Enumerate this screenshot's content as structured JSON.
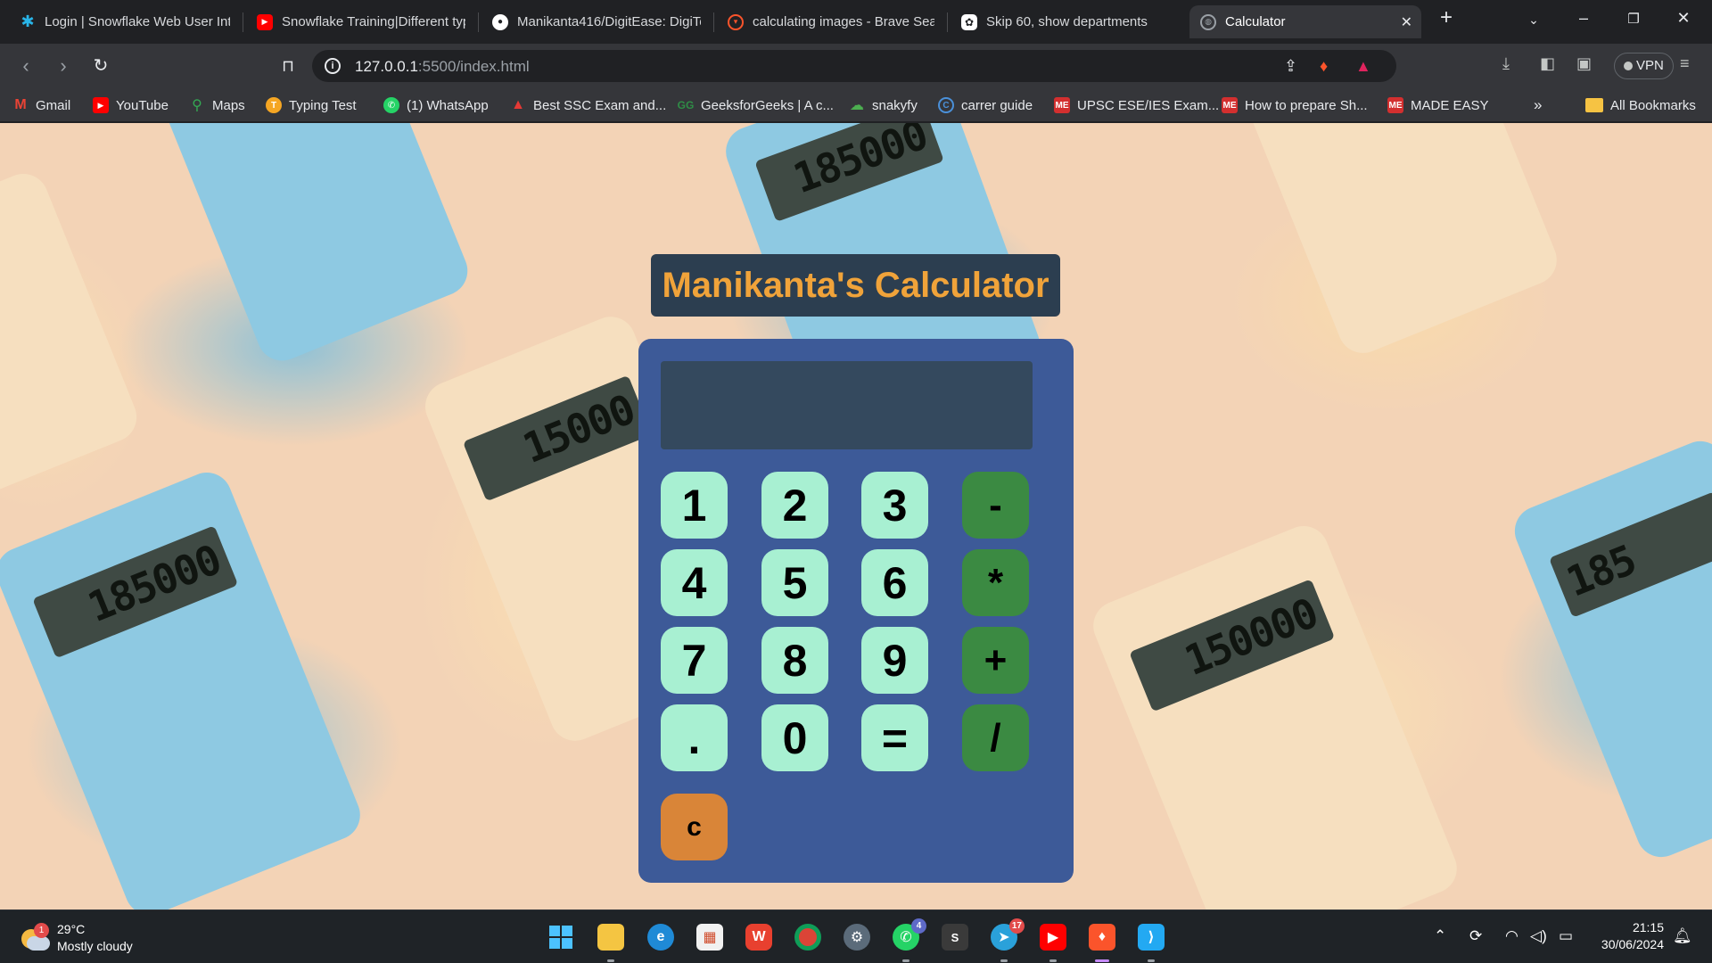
{
  "browser": {
    "tabs": [
      {
        "label": "Login | Snowflake Web User Int",
        "icon": "snowflake-icon",
        "color": "#29b5e8"
      },
      {
        "label": "Snowflake Training|Different typ",
        "icon": "youtube-icon",
        "color": "#ff0000"
      },
      {
        "label": "Manikanta416/DigitEase: DigiTe",
        "icon": "github-icon",
        "color": "#ffffff"
      },
      {
        "label": "calculating images - Brave Searc",
        "icon": "brave-search-icon",
        "color": "#fb542b"
      },
      {
        "label": "Skip 60, show departments",
        "icon": "chatgpt-icon",
        "color": "#ffffff"
      },
      {
        "label": "Calculator",
        "icon": "globe-icon",
        "color": "#9aa0a6",
        "active": true
      }
    ],
    "address": {
      "host": "127.0.0.1",
      "rest": ":5500/index.html"
    },
    "vpn_label": "VPN",
    "bookmarks": [
      {
        "label": "Gmail",
        "icon": "gmail-icon",
        "color": "#ea4335"
      },
      {
        "label": "YouTube",
        "icon": "youtube-icon",
        "color": "#ff0000"
      },
      {
        "label": "Maps",
        "icon": "maps-icon",
        "color": "#34a853"
      },
      {
        "label": "Typing Test",
        "icon": "typing-test-icon",
        "color": "#f5a623"
      },
      {
        "label": "(1) WhatsApp",
        "icon": "whatsapp-icon",
        "color": "#25d366"
      },
      {
        "label": "Best SSC Exam and...",
        "icon": "ssc-icon",
        "color": "#e53935"
      },
      {
        "label": "GeeksforGeeks | A c...",
        "icon": "geeksforgeeks-icon",
        "color": "#2f8d46"
      },
      {
        "label": "snakyfy",
        "icon": "snakyfy-icon",
        "color": "#4caf50"
      },
      {
        "label": "carrer guide",
        "icon": "career-guide-icon",
        "color": "#4a90d9"
      },
      {
        "label": "UPSC ESE/IES Exam...",
        "icon": "made-easy-icon",
        "color": "#d32f2f"
      },
      {
        "label": "How to prepare Sh...",
        "icon": "made-easy-icon",
        "color": "#d32f2f"
      },
      {
        "label": "MADE EASY",
        "icon": "made-easy-icon",
        "color": "#d32f2f"
      }
    ],
    "all_bookmarks_label": "All Bookmarks"
  },
  "page": {
    "title": "Manikanta's Calculator",
    "display_value": "",
    "keys": {
      "k1": "1",
      "k2": "2",
      "k3": "3",
      "minus": "-",
      "k4": "4",
      "k5": "5",
      "k6": "6",
      "multiply": "*",
      "k7": "7",
      "k8": "8",
      "k9": "9",
      "plus": "+",
      "dot": ".",
      "k0": "0",
      "equals": "=",
      "divide": "/",
      "clear": "c"
    },
    "background_display_texts": [
      "185000",
      "185000",
      "15000",
      "150000",
      "185"
    ]
  },
  "taskbar": {
    "weather": {
      "temp": "29°C",
      "condition": "Mostly cloudy",
      "badge": "1"
    },
    "whatsapp_badge": "4",
    "telegram_badge": "17",
    "clock": {
      "time": "21:15",
      "date": "30/06/2024"
    }
  },
  "colors": {
    "title_bg": "#2c3e50",
    "title_text": "#f0a33a",
    "calculator_bg": "#3d5a98",
    "display_bg": "#34495e",
    "number_key": "#a8f0d2",
    "operator_key": "#3b8a42",
    "clear_key": "#d98538"
  }
}
